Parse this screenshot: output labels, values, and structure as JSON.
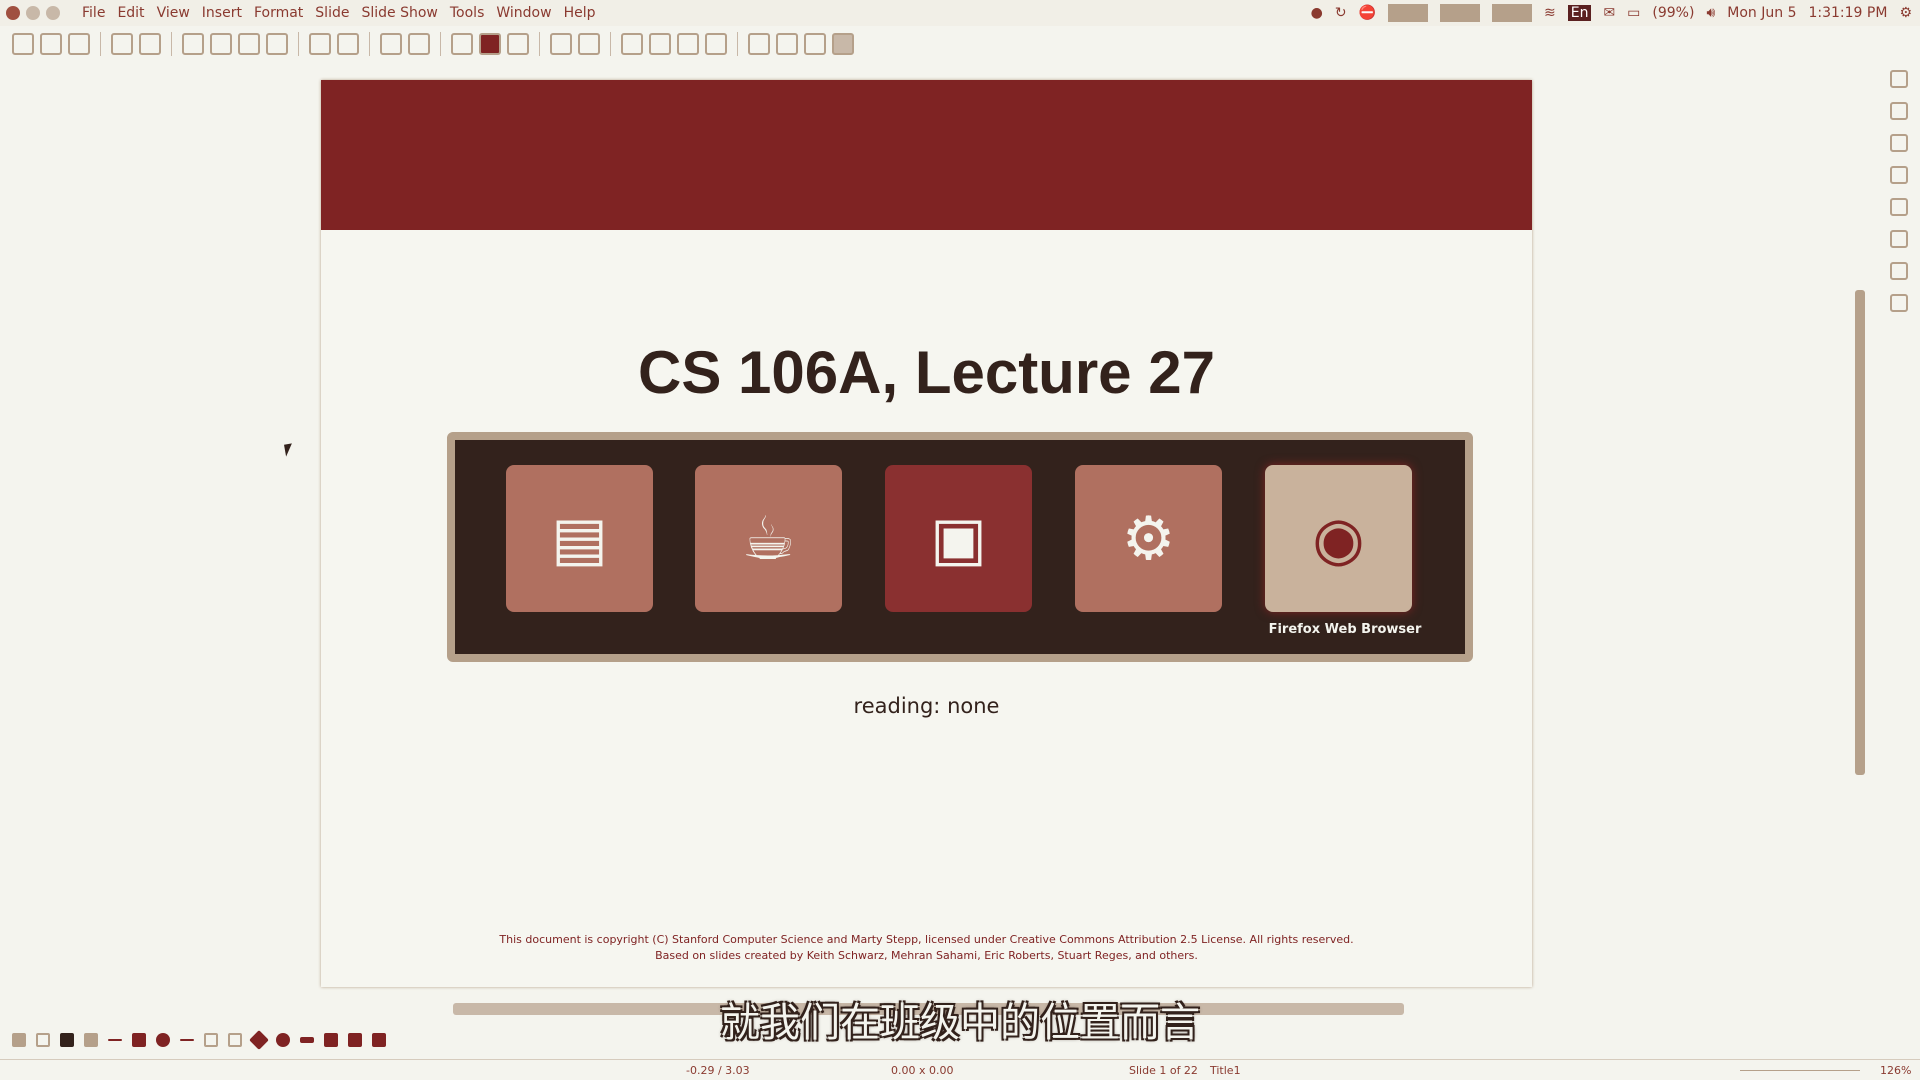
{
  "menubar": {
    "items": [
      "File",
      "Edit",
      "View",
      "Insert",
      "Format",
      "Slide",
      "Slide Show",
      "Tools",
      "Window",
      "Help"
    ]
  },
  "tray": {
    "keyboard": "En",
    "battery": "(99%)",
    "date": "Mon Jun 5",
    "time": "1:31:19 PM"
  },
  "slide": {
    "title": "CS 106A, Lecture 27",
    "reading": "reading: none",
    "footer_line1": "This document is copyright (C) Stanford Computer Science and Marty Stepp, licensed under Creative Commons Attribution 2.5 License.  All rights reserved.",
    "footer_line2": "Based on slides created by Keith Schwarz, Mehran Sahami, Eric Roberts, Stuart Reges, and others."
  },
  "switcher": {
    "apps": [
      {
        "name": "libreoffice-impress-icon",
        "glyph": "▤"
      },
      {
        "name": "teapot-icon",
        "glyph": "☕"
      },
      {
        "name": "file-cabinet-icon",
        "glyph": "▣"
      },
      {
        "name": "java-ee-ide-icon",
        "glyph": "⚙"
      },
      {
        "name": "firefox-icon",
        "glyph": "◉"
      }
    ],
    "selected_label": "Firefox Web Browser"
  },
  "subtitle": "就我们在班级中的位置而言",
  "status": {
    "position": "-0.29 / 3.03",
    "size": "0.00 x 0.00",
    "slide": "Slide 1 of 22",
    "layout": "Title1",
    "zoom": "126%"
  },
  "colors": {
    "accent": "#7f2323",
    "dark": "#33221c",
    "tan": "#b5a08a"
  }
}
